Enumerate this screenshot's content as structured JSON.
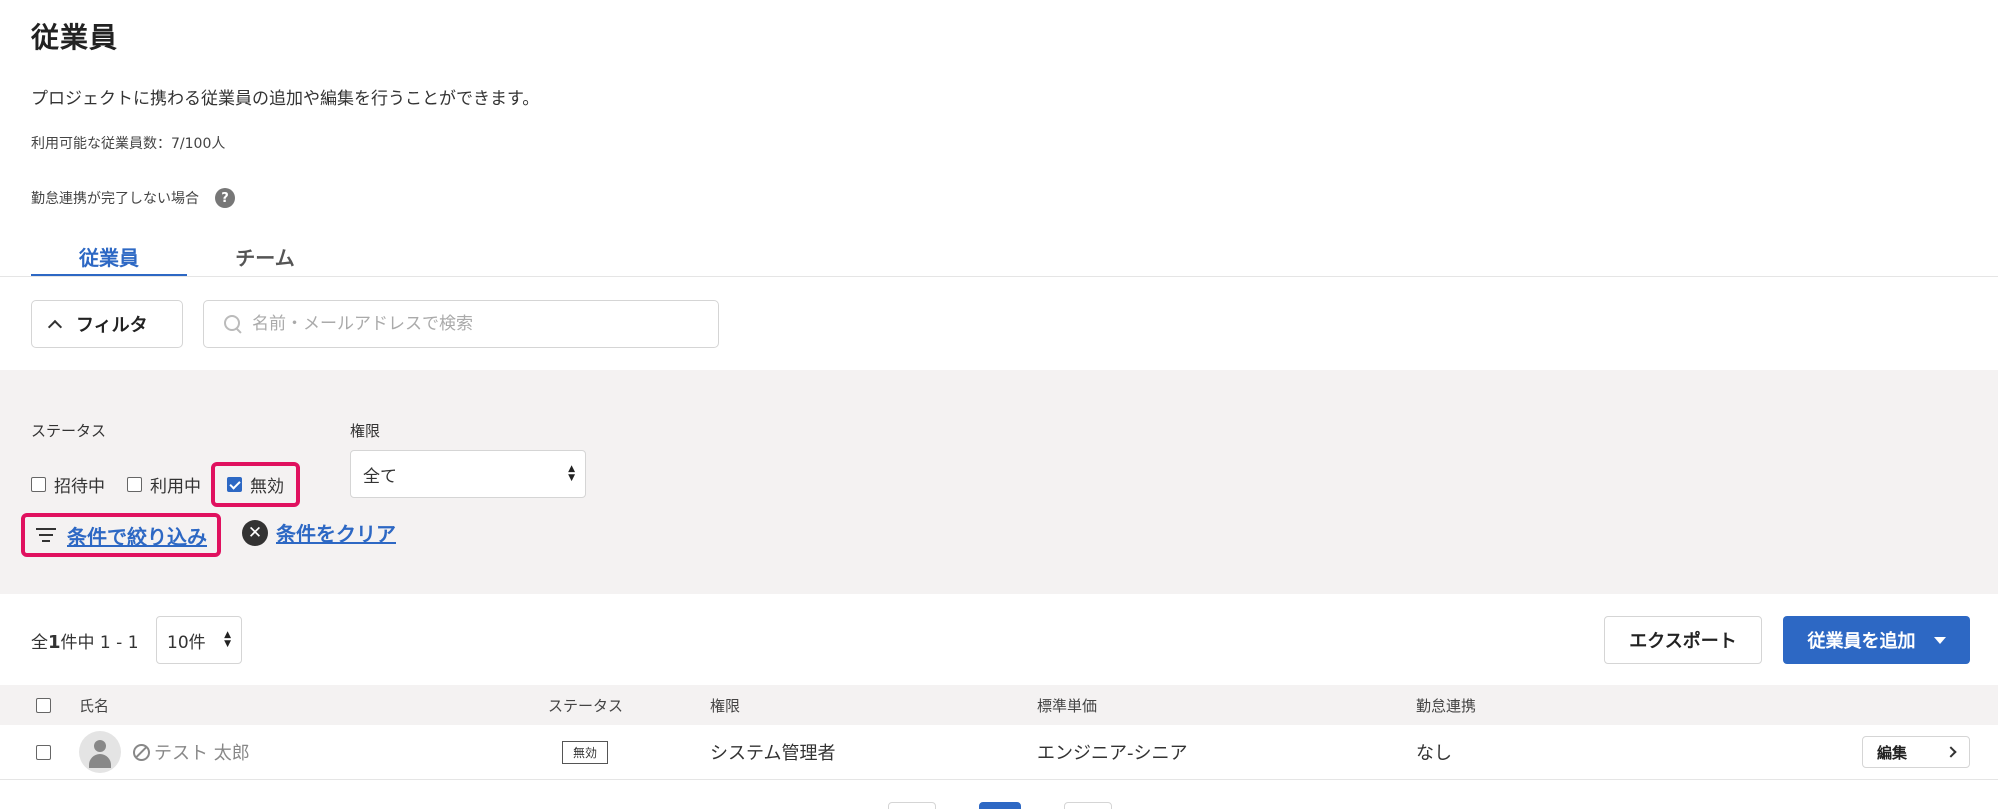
{
  "page": {
    "title": "従業員",
    "description": "プロジェクトに携わる従業員の追加や編集を行うことができます。",
    "quota": "利用可能な従業員数：7/100人",
    "help_text": "勤怠連携が完了しない場合",
    "help_icon": "question-circle-icon"
  },
  "tabs": [
    {
      "label": "従業員",
      "active": true
    },
    {
      "label": "チーム",
      "active": false
    }
  ],
  "toolbar": {
    "filter_label": "フィルタ",
    "search_placeholder": "名前・メールアドレスで検索",
    "search_value": ""
  },
  "filters": {
    "status_label": "ステータス",
    "status_options": [
      {
        "label": "招待中",
        "checked": false
      },
      {
        "label": "利用中",
        "checked": false
      },
      {
        "label": "無効",
        "checked": true
      }
    ],
    "permission_label": "権限",
    "permission_value": "全て",
    "apply_label": "条件で絞り込み",
    "clear_label": "条件をクリア"
  },
  "list": {
    "count_prefix": "全",
    "count_total": "1",
    "count_suffix": "件中 1 - 1",
    "per_page": "10件",
    "export_label": "エクスポート",
    "add_label": "従業員を追加",
    "columns": [
      "氏名",
      "ステータス",
      "権限",
      "標準単価",
      "勤怠連携"
    ],
    "rows": [
      {
        "name": "テスト 太郎",
        "status": "無効",
        "permission": "システム管理者",
        "unit_price": "エンジニア-シニア",
        "attendance": "なし",
        "edit_label": "編集"
      }
    ]
  },
  "colors": {
    "accent": "#2d68c4",
    "highlight": "#e0115f",
    "panel_bg": "#f4f2f2"
  }
}
